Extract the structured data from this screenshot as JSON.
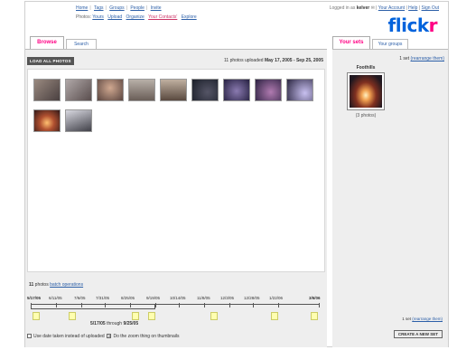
{
  "header": {
    "top_links": [
      "Home",
      "Tags",
      "Groups",
      "People",
      "Invite"
    ],
    "photos_label": "Photos:",
    "photo_links": [
      "Yours",
      "Upload",
      "Organize",
      "Your Contacts'",
      "Explore"
    ],
    "logged_in_as": "Logged in as",
    "username": "kelver",
    "account_links": [
      "Your Account",
      "Help",
      "Sign Out"
    ],
    "logo_part1": "flick",
    "logo_part2": "r"
  },
  "tabs": {
    "browse": "Browse",
    "search": "Search",
    "your_sets": "Your sets",
    "your_groups": "Your groups"
  },
  "main": {
    "load_button": "LOAD ALL PHOTOS",
    "upload_info_prefix": "11 photos uploaded",
    "upload_range": "May 17, 2005 - Sep 25, 2005",
    "photo_count": "11",
    "photo_count_suffix": " photos",
    "batch_link": "batch operations",
    "photos": [
      {
        "name": "photo-1",
        "color": "#7a6a60"
      },
      {
        "name": "photo-2",
        "color": "#8b7d78"
      },
      {
        "name": "photo-3",
        "color": "#6e5a55"
      },
      {
        "name": "photo-4",
        "color": "#9a8a80"
      },
      {
        "name": "photo-5",
        "color": "#7c6c5e"
      },
      {
        "name": "photo-6",
        "color": "#2a2e3a"
      },
      {
        "name": "photo-7",
        "color": "#3a3550"
      },
      {
        "name": "photo-8",
        "color": "#4a3a5a"
      },
      {
        "name": "photo-9",
        "color": "#2a2540"
      },
      {
        "name": "photo-10",
        "color": "#c86a3a"
      },
      {
        "name": "photo-11",
        "color": "#5a5a60"
      }
    ]
  },
  "timeline": {
    "labels": [
      "5/17/05",
      "6/11/05",
      "7/6/05",
      "7/31/05",
      "8/25/05",
      "9/19/05",
      "10/14/05",
      "11/8/05",
      "12/3/05",
      "12/28/05",
      "1/22/06",
      "3/6/06"
    ],
    "range_start": "5/17/05",
    "range_through": "through",
    "range_end": "9/25/05",
    "option_date_taken": "Use date taken instead of uploaded",
    "option_zoom": "Do the zoom thing on thumbnails",
    "zoom_checked": "✕"
  },
  "sidebar": {
    "set_count_prefix": "1 set",
    "rearrange_link": "(rearrange them)",
    "set_name": "Foothills",
    "set_photos": "(3 photos)",
    "set_count_bottom_prefix": "1 set",
    "rearrange_link_bottom": "(rearrange them)",
    "create_button": "CREATE A NEW SET"
  }
}
